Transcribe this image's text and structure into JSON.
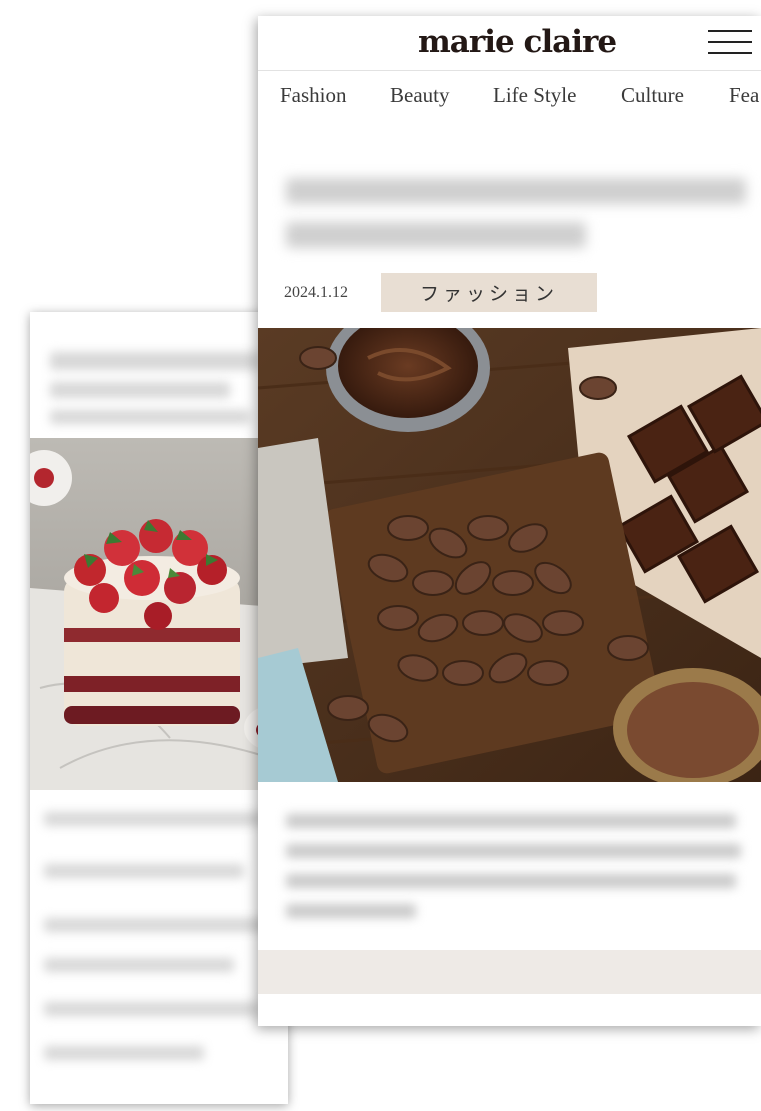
{
  "brand": {
    "logo_text": "marie claire"
  },
  "nav": {
    "items": [
      {
        "label": "Fashion"
      },
      {
        "label": "Beauty"
      },
      {
        "label": "Life Style"
      },
      {
        "label": "Culture"
      },
      {
        "label": "Fea"
      }
    ]
  },
  "article": {
    "date": "2024.1.12",
    "category": "ファッション"
  },
  "icons": {
    "menu": "hamburger-menu-icon"
  },
  "colors": {
    "category_bg": "#e8ded3",
    "logo": "#231815",
    "footer_band": "#eeeae6"
  }
}
